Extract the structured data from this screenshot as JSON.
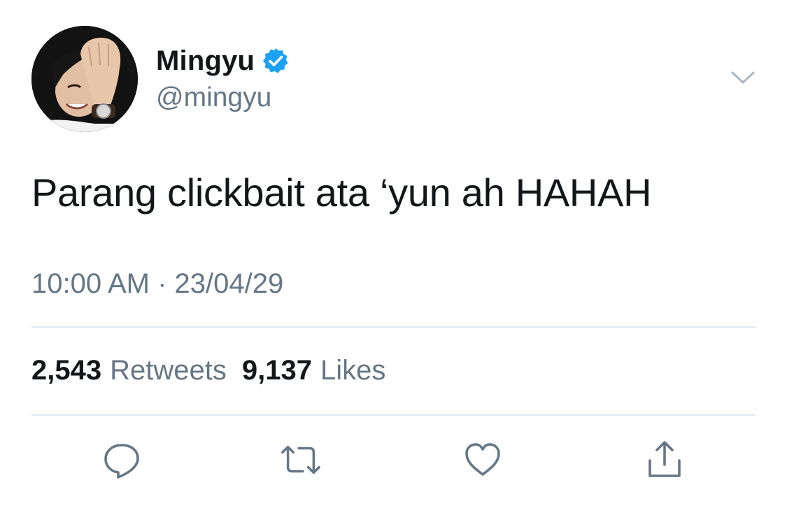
{
  "author": {
    "display_name": "Mingyu",
    "handle": "@mingyu",
    "verified": true,
    "avatar_icon": "profile-photo"
  },
  "tweet": {
    "text": "Parang clickbait ata ‘yun ah HAHAH",
    "timestamp": "10:00 AM · 23/04/29"
  },
  "stats": {
    "retweets_count": "2,543",
    "retweets_label": "Retweets",
    "likes_count": "9,137",
    "likes_label": "Likes"
  },
  "actions": [
    {
      "name": "reply",
      "icon": "speech-bubble-icon"
    },
    {
      "name": "retweet",
      "icon": "retweet-arrows-icon"
    },
    {
      "name": "like",
      "icon": "heart-icon"
    },
    {
      "name": "share",
      "icon": "share-upload-icon"
    }
  ],
  "colors": {
    "text_primary": "#14171a",
    "text_secondary": "#657786",
    "verified_blue": "#1da1f2",
    "divider": "#e1e8ed"
  }
}
